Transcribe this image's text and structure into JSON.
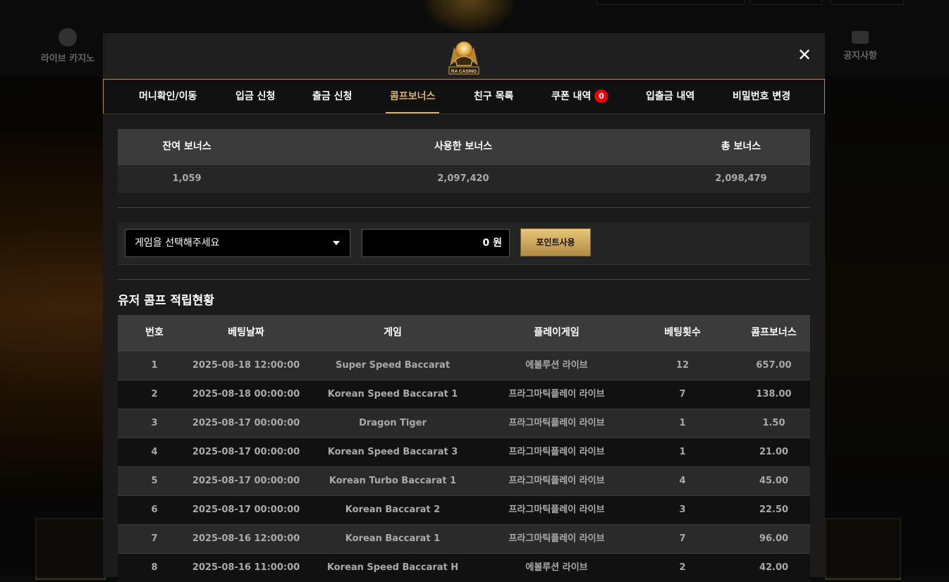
{
  "background": {
    "nav_left_label": "라이브 카지노",
    "nav_right_label": "공지사항"
  },
  "modal": {
    "logo_text": "RA CASINO",
    "close_symbol": "✕",
    "tabs": [
      {
        "label": "머니확인/이동",
        "active": false
      },
      {
        "label": "입금 신청",
        "active": false
      },
      {
        "label": "출금 신청",
        "active": false
      },
      {
        "label": "콤프보너스",
        "active": true
      },
      {
        "label": "친구 목록",
        "active": false
      },
      {
        "label": "쿠폰 내역",
        "active": false,
        "badge": "0"
      },
      {
        "label": "입출금 내역",
        "active": false
      },
      {
        "label": "비밀번호 변경",
        "active": false
      }
    ]
  },
  "summary": {
    "headers": [
      "잔여 보너스",
      "사용한 보너스",
      "총 보너스"
    ],
    "values": [
      "1,059",
      "2,097,420",
      "2,098,479"
    ]
  },
  "redeem_form": {
    "game_select_value": "게임을 선택해주세요",
    "amount_value": "0 원",
    "use_button_label": "포인트사용"
  },
  "history": {
    "title": "유저 콤프 적립현황",
    "columns": [
      "번호",
      "베팅날짜",
      "게임",
      "플레이게임",
      "베팅횟수",
      "콤프보너스"
    ],
    "rows": [
      [
        "1",
        "2025-08-18 12:00:00",
        "Super Speed Baccarat",
        "에볼루션 라이브",
        "12",
        "657.00"
      ],
      [
        "2",
        "2025-08-18 00:00:00",
        "Korean Speed Baccarat 1",
        "프라그마틱플레이 라이브",
        "7",
        "138.00"
      ],
      [
        "3",
        "2025-08-17 00:00:00",
        "Dragon Tiger",
        "프라그마틱플레이 라이브",
        "1",
        "1.50"
      ],
      [
        "4",
        "2025-08-17 00:00:00",
        "Korean Speed Baccarat 3",
        "프라그마틱플레이 라이브",
        "1",
        "21.00"
      ],
      [
        "5",
        "2025-08-17 00:00:00",
        "Korean Turbo Baccarat 1",
        "프라그마틱플레이 라이브",
        "4",
        "45.00"
      ],
      [
        "6",
        "2025-08-17 00:00:00",
        "Korean Baccarat 2",
        "프라그마틱플레이 라이브",
        "3",
        "22.50"
      ],
      [
        "7",
        "2025-08-16 12:00:00",
        "Korean Baccarat 1",
        "프라그마틱플레이 라이브",
        "7",
        "96.00"
      ],
      [
        "8",
        "2025-08-16 11:00:00",
        "Korean Speed Baccarat H",
        "에볼루션 라이브",
        "2",
        "42.00"
      ]
    ]
  },
  "colors": {
    "accent_gold": "#d9b26c",
    "badge_red": "#e00000",
    "header_gray": "#3b3b3b"
  }
}
